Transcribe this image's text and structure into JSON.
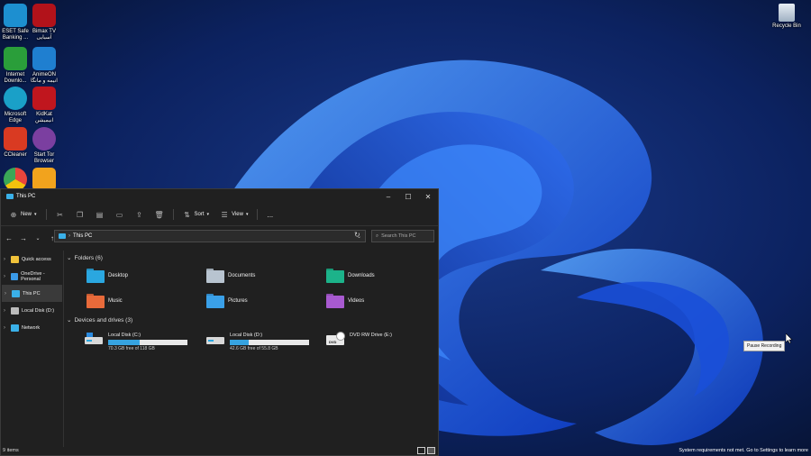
{
  "desktop": {
    "icons": [
      {
        "label": "ESET Safe\nBanking ...",
        "icon": "eset-icon",
        "color": "#1d8fd0"
      },
      {
        "label": "Bimax TV\nآسیایی",
        "icon": "bimax-tv-icon",
        "color": "#b2121a"
      },
      {
        "label": "Internet\nDownlo...",
        "icon": "internet-download-manager-icon",
        "color": "#2a9e3a"
      },
      {
        "label": "AnimeON\nانیمه و مانگا",
        "icon": "animeon-icon",
        "color": "#1f7fd0"
      },
      {
        "label": "Microsoft\nEdge",
        "icon": "edge-icon",
        "color": "#1aa0c8"
      },
      {
        "label": "KidKat\nانیمیشن",
        "icon": "kidkat-icon",
        "color": "#c0161e"
      },
      {
        "label": "CCleaner",
        "icon": "ccleaner-icon",
        "color": "#d93a22"
      },
      {
        "label": "Start Tor\nBrowser",
        "icon": "tor-icon",
        "color": "#7b3fa0"
      },
      {
        "label": "",
        "icon": "chrome-icon",
        "color": "#e8453c"
      },
      {
        "label": "",
        "icon": "m-app-icon",
        "color": "#f2a31d"
      }
    ],
    "recycle_bin": "Recycle Bin",
    "pause_tooltip": "Pause Recording",
    "system_message": "System requirements not met. Go to Settings to learn more"
  },
  "explorer": {
    "title": "This PC",
    "toolbar": {
      "new": "New",
      "sort": "Sort",
      "view": "View",
      "more": "..."
    },
    "address": "This PC",
    "search_placeholder": "Search This PC",
    "sidebar": [
      {
        "label": "Quick access",
        "icon": "star-icon",
        "color": "#f0c23a"
      },
      {
        "label": "OneDrive - Personal",
        "icon": "onedrive-icon",
        "color": "#3a9ae8"
      },
      {
        "label": "This PC",
        "icon": "pc-icon",
        "color": "#3ab0e8"
      },
      {
        "label": "Local Disk (D:)",
        "icon": "disk-icon",
        "color": "#bbbbbb"
      },
      {
        "label": "Network",
        "icon": "network-icon",
        "color": "#3ab0e8"
      }
    ],
    "folders_header": "Folders (6)",
    "folders": [
      {
        "label": "Desktop",
        "icon": "desktop-folder-icon",
        "color": "#2aa7e0"
      },
      {
        "label": "Documents",
        "icon": "documents-folder-icon",
        "color": "#b8c4d0"
      },
      {
        "label": "Downloads",
        "icon": "downloads-folder-icon",
        "color": "#1cb38a"
      },
      {
        "label": "Music",
        "icon": "music-folder-icon",
        "color": "#e86a3a"
      },
      {
        "label": "Pictures",
        "icon": "pictures-folder-icon",
        "color": "#3aa0e8"
      },
      {
        "label": "Videos",
        "icon": "videos-folder-icon",
        "color": "#a85ad0"
      }
    ],
    "drives_header": "Devices and drives (3)",
    "drives": [
      {
        "label": "Local Disk (C:)",
        "free": "70.3 GB free of 118 GB",
        "used_fraction": 0.4
      },
      {
        "label": "Local Disk (D:)",
        "free": "42.6 GB free of 55.8 GB",
        "used_fraction": 0.24
      },
      {
        "label": "DVD RW Drive (E:)",
        "free": "",
        "icon_text": "DVD"
      }
    ],
    "status": "9 items"
  }
}
